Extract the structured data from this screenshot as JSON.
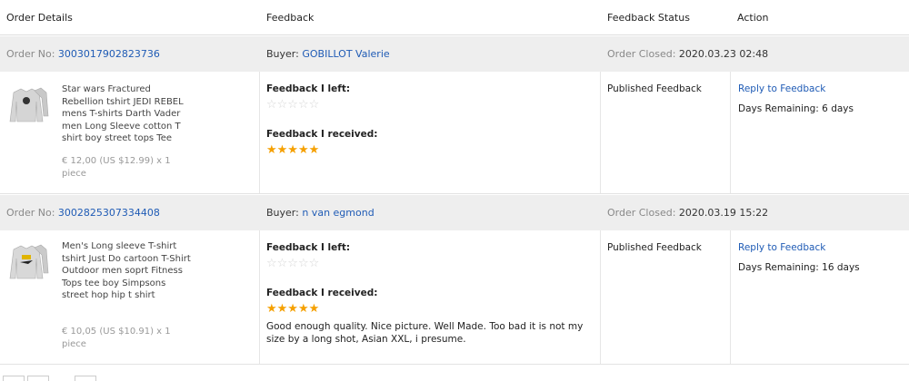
{
  "header": {
    "order_details": "Order Details",
    "feedback": "Feedback",
    "feedback_status": "Feedback Status",
    "action": "Action"
  },
  "orders": [
    {
      "order_no_label": "Order No:",
      "order_no": "3003017902823736",
      "buyer_label": "Buyer:",
      "buyer": "GOBILLOT Valerie",
      "closed_label": "Order Closed:",
      "closed_date": "2020.03.23 02:48",
      "product_title": "Star wars Fractured Rebellion tshirt JEDI REBEL mens T-shirts Darth Vader men Long Sleeve cotton T shirt boy street tops Tee",
      "price": "€ 12,00 (US $12.99) x 1 piece",
      "feedback_left_label": "Feedback I left:",
      "feedback_left_rating": 0,
      "feedback_received_label": "Feedback I received:",
      "feedback_received_rating": 5,
      "comment": "",
      "status": "Published Feedback",
      "reply_link": "Reply to Feedback",
      "days_remaining": "Days Remaining: 6 days"
    },
    {
      "order_no_label": "Order No:",
      "order_no": "3002825307334408",
      "buyer_label": "Buyer:",
      "buyer": "n van egmond",
      "closed_label": "Order Closed:",
      "closed_date": "2020.03.19 15:22",
      "product_title": "Men's Long sleeve T-shirt tshirt Just Do cartoon T-Shirt Outdoor men soprt Fitness Tops tee boy Simpsons street hop hip t shirt",
      "price": "€ 10,05 (US $10.91) x 1 piece",
      "feedback_left_label": "Feedback I left:",
      "feedback_left_rating": 0,
      "feedback_received_label": "Feedback I received:",
      "feedback_received_rating": 5,
      "comment": "Good enough quality. Nice picture. Well Made. Too bad it is not my size by a long shot, Asian XXL, i presume.",
      "status": "Published Feedback",
      "reply_link": "Reply to Feedback",
      "days_remaining": "Days Remaining: 16 days"
    }
  ],
  "stars": {
    "empty": "☆☆☆☆☆",
    "full": "★★★★★"
  },
  "colors": {
    "link": "#1f5bb5",
    "star": "#f5a000",
    "bar": "#eeeeee"
  }
}
